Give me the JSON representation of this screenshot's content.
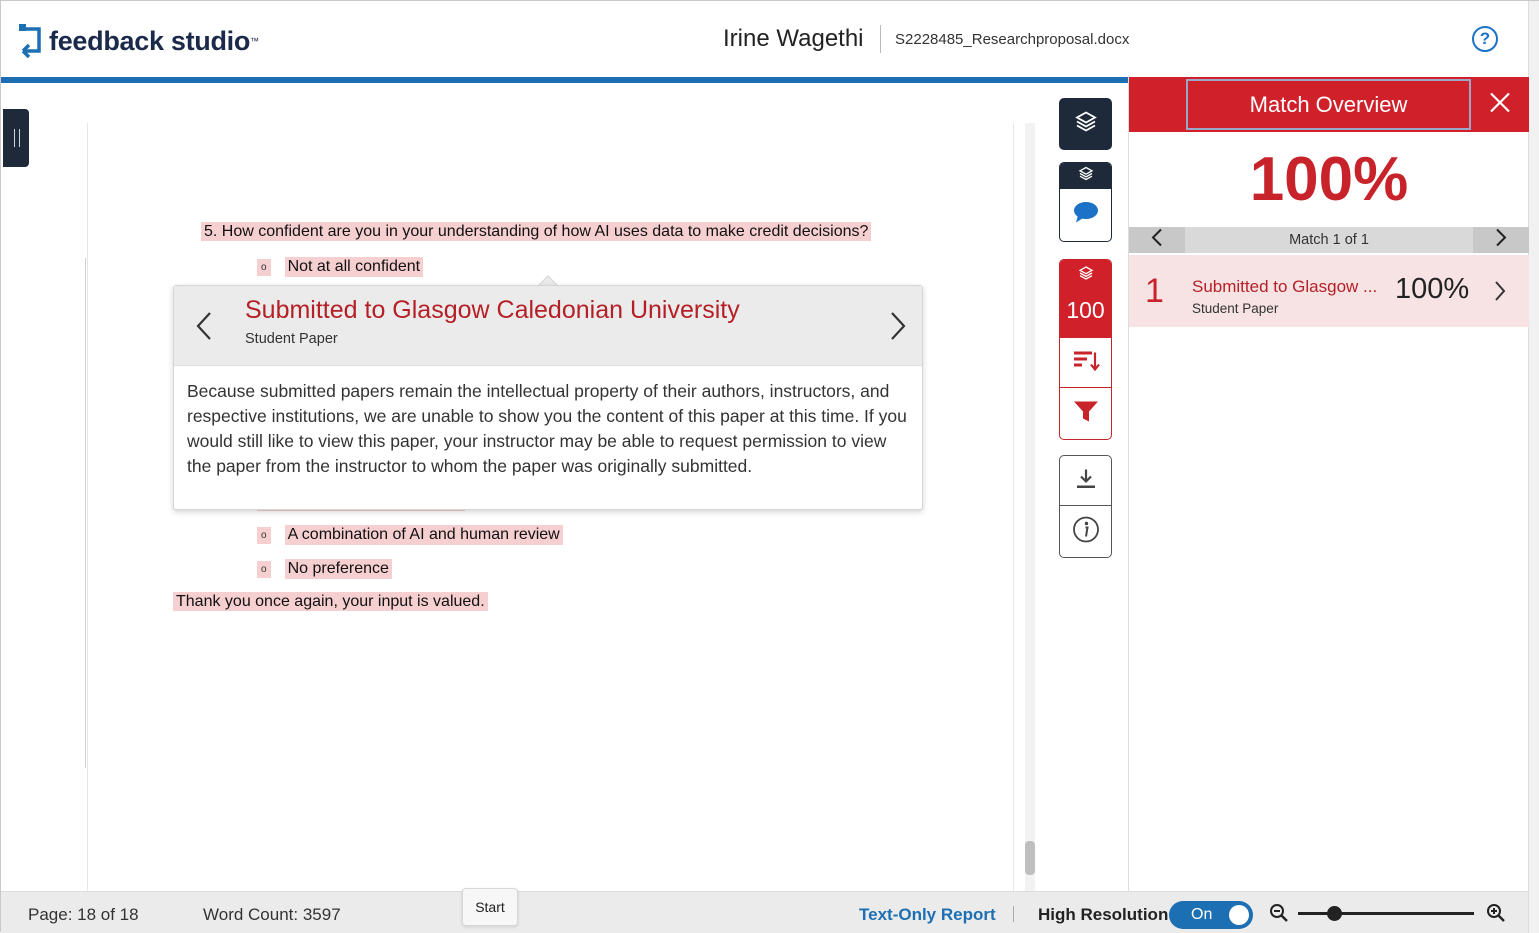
{
  "header": {
    "logo_text": "feedback studio",
    "student_name": "Irine Wagethi",
    "file_name": "S2228485_Researchproposal.docx",
    "help_symbol": "?"
  },
  "document": {
    "question": "5.   How confident are you in your understanding of how AI uses data to make credit decisions?",
    "bullet_symbol": "o",
    "options": [
      "Not at all confident",
      "A combination of AI and human review",
      "No preference"
    ],
    "closing": "Thank you once again, your input is valued."
  },
  "popover": {
    "source_title": "Submitted to Glasgow Caledonian University",
    "source_type": "Student Paper",
    "body": "Because submitted papers remain the intellectual property of their authors, instructors, and respective institutions, we are unable to show you the content of this paper at this time. If you would still like to view this paper, your instructor may be able to request permission to view the paper from the instructor to whom the paper was originally submitted."
  },
  "tools": {
    "similarity_score": "100"
  },
  "match_panel": {
    "title": "Match Overview",
    "overall_percent": "100%",
    "nav_text": "Match 1 of 1",
    "matches": [
      {
        "rank": "1",
        "source": "Submitted to Glasgow ...",
        "type": "Student Paper",
        "percent": "100%"
      }
    ]
  },
  "footer": {
    "page": "Page: 18 of 18",
    "word_count": "Word Count: 3597",
    "start_tooltip": "Start",
    "text_only_report": "Text-Only Report",
    "high_resolution_label": "High Resolution",
    "high_resolution_toggle": "On",
    "zoom_level": 0.21
  },
  "colors": {
    "accent_red": "#d0202a",
    "accent_blue": "#1d6fb3",
    "navy": "#1e2a3a",
    "highlight": "#f6cfd1"
  },
  "icons": [
    "feedback-studio-logo-icon",
    "help-icon",
    "sidebar-handle-icon",
    "layers-icon",
    "comment-icon",
    "sort-icon",
    "filter-icon",
    "download-icon",
    "info-icon",
    "chevron-left-icon",
    "chevron-right-icon",
    "close-icon",
    "zoom-out-icon",
    "zoom-in-icon"
  ]
}
